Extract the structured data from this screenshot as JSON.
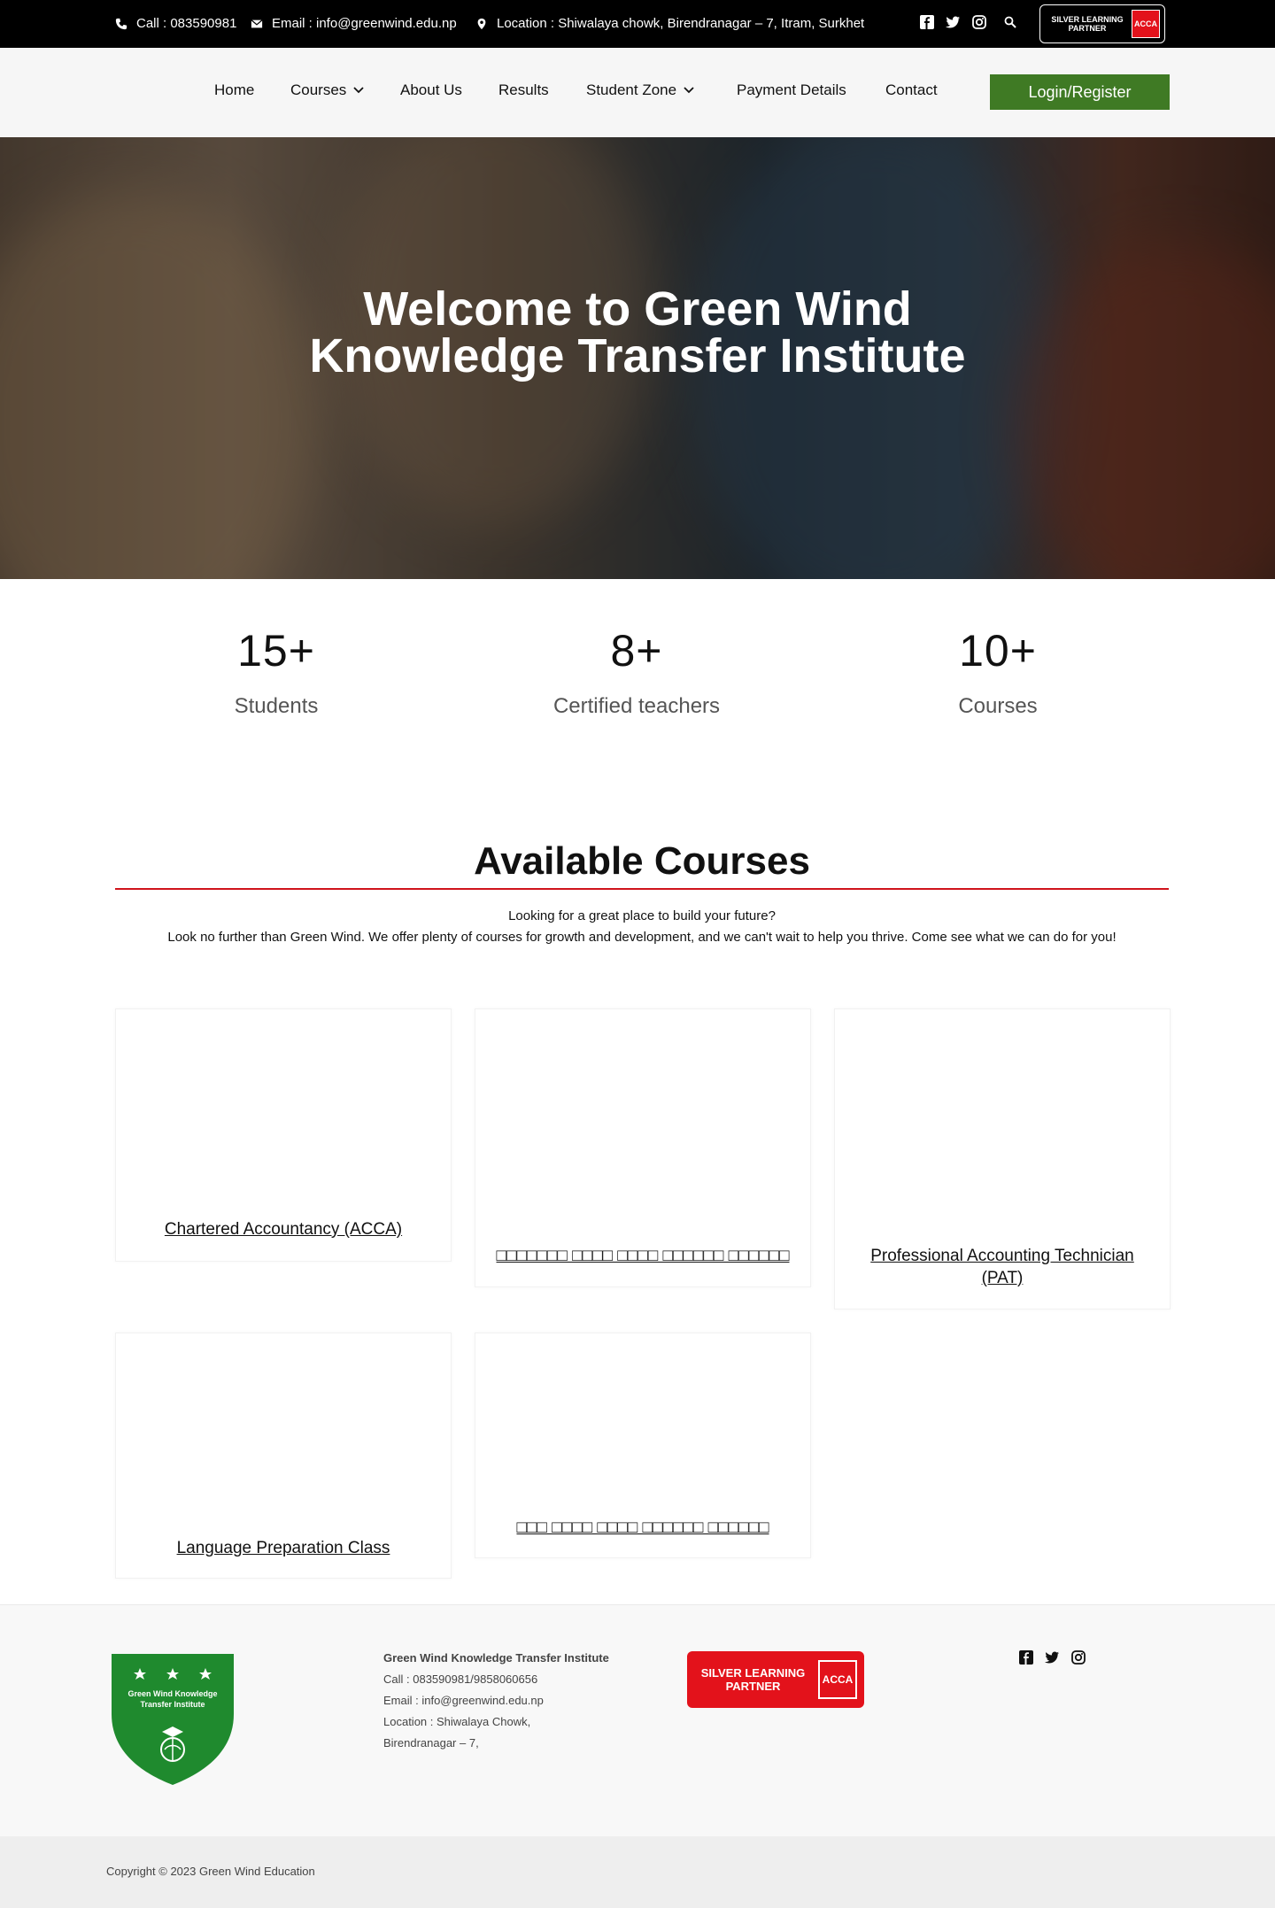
{
  "topbar": {
    "call": "Call : 083590981",
    "email": "Email : info@greenwind.edu.np",
    "location": "Location : Shiwalaya chowk, Birendranagar – 7, Itram, Surkhet",
    "social_icons": [
      "facebook-icon",
      "twitter-icon",
      "instagram-icon"
    ],
    "search_icon": "search-icon",
    "acca_badge_text": "SILVER LEARNING PARTNER",
    "acca_logo": "ACCA"
  },
  "nav": {
    "items": [
      {
        "label": "Home",
        "dropdown": false
      },
      {
        "label": "Courses",
        "dropdown": true
      },
      {
        "label": "About Us",
        "dropdown": false
      },
      {
        "label": "Results",
        "dropdown": false
      },
      {
        "label": "Student Zone",
        "dropdown": true
      },
      {
        "label": "Payment Details",
        "dropdown": false
      },
      {
        "label": "Contact",
        "dropdown": false
      }
    ],
    "login_label": "Login/Register"
  },
  "hero": {
    "title": "Welcome to Green Wind Knowledge Transfer Institute"
  },
  "stats": [
    {
      "value": "15+",
      "label": "Students"
    },
    {
      "value": "8+",
      "label": "Certified teachers"
    },
    {
      "value": "10+",
      "label": "Courses"
    }
  ],
  "courses": {
    "title": "Available Courses",
    "intro_line1": "Looking for a great place to build your future?",
    "intro_line2": "Look no further than Green Wind. We offer plenty of courses for growth and development, and we can't wait to help you thrive. Come see what we can do for you!",
    "cards": [
      {
        "title": "Chartered Accountancy (ACCA)"
      },
      {
        "title": "□□□□□□□ □□□□ □□□□ □□□□□□ □□□□□□"
      },
      {
        "title": "Professional Accounting Technician (PAT)"
      },
      {
        "title": "Language Preparation Class"
      },
      {
        "title": "□□□ □□□□ □□□□ □□□□□□ □□□□□□"
      }
    ]
  },
  "footer": {
    "logo_text": "Green Wind Knowledge Transfer Institute",
    "org_name": "Green Wind Knowledge Transfer Institute",
    "call": "Call : 083590981/9858060656",
    "email": "Email : info@greenwind.edu.np",
    "location_line1": "Location : Shiwalaya Chowk,",
    "location_line2": "Birendranagar – 7,",
    "acca_badge_text": "SILVER LEARNING PARTNER",
    "acca_logo": "ACCA",
    "social_icons": [
      "facebook-icon",
      "twitter-icon",
      "instagram-icon"
    ]
  },
  "copyright": "Copyright © 2023 Green Wind Education",
  "colors": {
    "brand_green": "#3f7a24",
    "accent_red": "#d0141c",
    "topbar_bg": "#000000"
  }
}
